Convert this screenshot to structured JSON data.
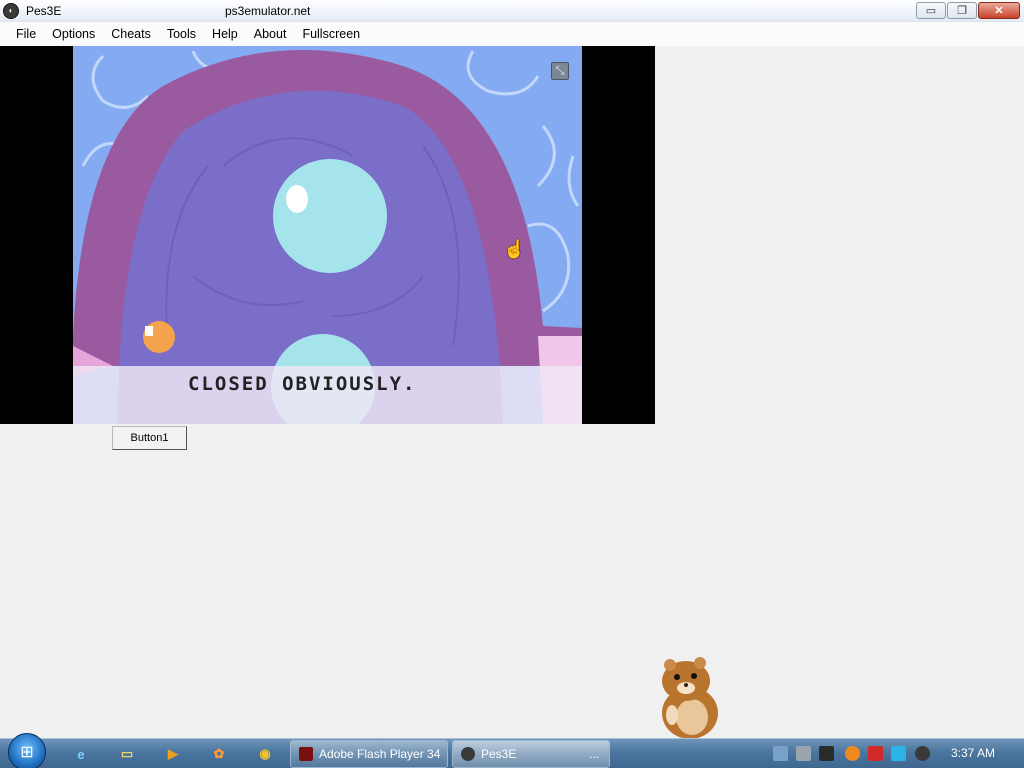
{
  "window": {
    "title": "Pes3E",
    "site": "ps3emulator.net",
    "minimize_glyph": "▭",
    "restore_glyph": "❐",
    "close_glyph": "✕"
  },
  "menu": [
    "File",
    "Options",
    "Cheats",
    "Tools",
    "Help",
    "About",
    "Fullscreen"
  ],
  "game": {
    "dialog_text": "CLOSED OBVIOUSLY.",
    "mute_icon": "⤡",
    "cursor_icon": "hand-pointer"
  },
  "button1_label": "Button1",
  "taskbar": {
    "start_icon": "windows-logo",
    "pinned": [
      {
        "icon": "internet-explorer-icon",
        "glyph": "e"
      },
      {
        "icon": "folder-icon",
        "glyph": "▭"
      },
      {
        "icon": "media-player-icon",
        "glyph": "▶"
      },
      {
        "icon": "gadget-icon",
        "glyph": "✿"
      },
      {
        "icon": "chrome-icon",
        "glyph": "◉"
      }
    ],
    "tasks": [
      {
        "label": "Adobe Flash Player 34",
        "icon": "flash-icon"
      },
      {
        "label": "Pes3E",
        "trailing": "...",
        "icon": "pes3e-icon"
      }
    ],
    "clock": "3:37 AM"
  },
  "colors": {
    "game_sky": "#84aaf2",
    "arch": "#9a5aa0",
    "door": "#7a6ec9",
    "orb": "#a6e4ec",
    "taskbar": "#4b769f"
  }
}
